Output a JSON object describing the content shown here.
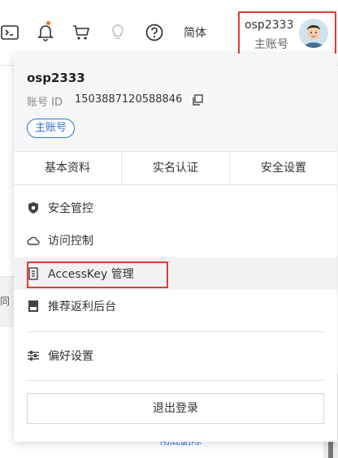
{
  "topbar": {
    "icons": [
      "terminal-icon",
      "bell-icon",
      "cart-icon",
      "lightbulb-icon",
      "help-icon"
    ],
    "language": "简体",
    "account_name": "osp2333",
    "account_role": "主账号",
    "notify_color": "#ff6a00"
  },
  "background": {
    "side_fragment": "同 、",
    "link_text": "彻底删除"
  },
  "dropdown": {
    "username": "osp2333",
    "id_label": "账号 ID",
    "id_value": "1503887120588846",
    "badge": "主账号",
    "tabs": [
      "基本资料",
      "实名认证",
      "安全设置"
    ],
    "items": [
      {
        "label": "安全管控",
        "icon": "shield-icon"
      },
      {
        "label": "访问控制",
        "icon": "cloud-icon"
      },
      {
        "label": "AccessKey 管理",
        "icon": "key-icon"
      },
      {
        "label": "推荐返利后台",
        "icon": "drive-icon"
      },
      {
        "label": "偏好设置",
        "icon": "sliders-icon"
      }
    ],
    "logout": "退出登录"
  },
  "colors": {
    "accent": "#2f6fd6",
    "highlight_border": "#e53935"
  }
}
